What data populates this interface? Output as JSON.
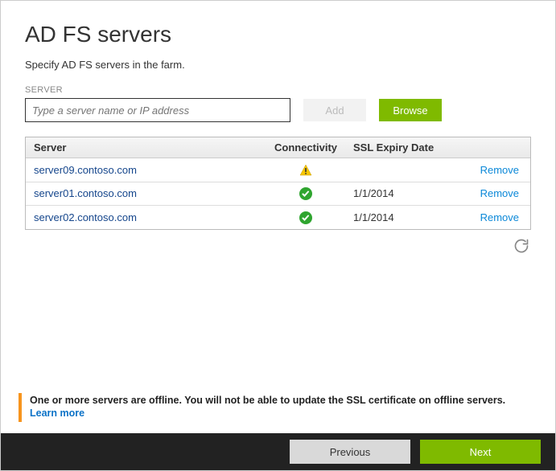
{
  "page": {
    "title": "AD FS servers",
    "subtitle": "Specify AD FS servers in the farm."
  },
  "serverInput": {
    "label": "SERVER",
    "placeholder": "Type a server name or IP address",
    "value": "",
    "addLabel": "Add",
    "browseLabel": "Browse"
  },
  "table": {
    "headers": {
      "server": "Server",
      "connectivity": "Connectivity",
      "sslExpiry": "SSL Expiry Date"
    },
    "rows": [
      {
        "server": "server09.contoso.com",
        "status": "warn",
        "sslExpiry": "",
        "action": "Remove"
      },
      {
        "server": "server01.contoso.com",
        "status": "ok",
        "sslExpiry": "1/1/2014",
        "action": "Remove"
      },
      {
        "server": "server02.contoso.com",
        "status": "ok",
        "sslExpiry": "1/1/2014",
        "action": "Remove"
      }
    ]
  },
  "alert": {
    "text": "One or more servers are offline. You will not be able to update the SSL certificate on offline servers.",
    "learnMore": "Learn more"
  },
  "footer": {
    "previous": "Previous",
    "next": "Next"
  }
}
